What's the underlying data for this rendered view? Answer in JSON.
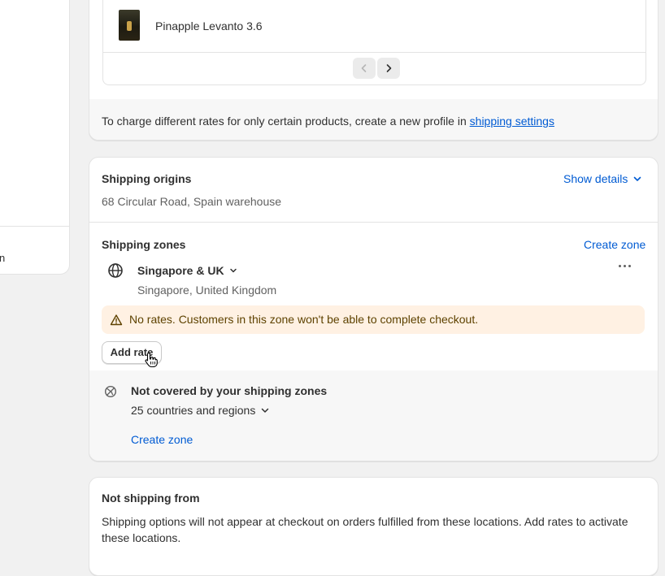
{
  "left_panel": {
    "clipped_text": "n"
  },
  "product_card": {
    "product_name": "Pinapple Levanto 3.6",
    "footer_text": "To charge different rates for only certain products, create a new profile in ",
    "footer_link": "shipping settings"
  },
  "shipping": {
    "origins_title": "Shipping origins",
    "origins_address": "68 Circular Road, Spain warehouse",
    "show_details": "Show details",
    "zones_title": "Shipping zones",
    "create_zone": "Create zone",
    "zone": {
      "name": "Singapore & UK",
      "countries": "Singapore, United Kingdom",
      "warning": "No rates. Customers in this zone won't be able to complete checkout.",
      "add_rate": "Add rate"
    },
    "uncovered": {
      "title": "Not covered by your shipping zones",
      "count": "25 countries and regions",
      "create_zone": "Create zone"
    }
  },
  "not_shipping": {
    "title": "Not shipping from",
    "text": "Shipping options will not appear at checkout on orders fulfilled from these locations. Add rates to activate these locations."
  },
  "colors": {
    "link": "#005bd3",
    "warning_bg": "#fff1e3",
    "page_bg": "#f1f1f1"
  }
}
